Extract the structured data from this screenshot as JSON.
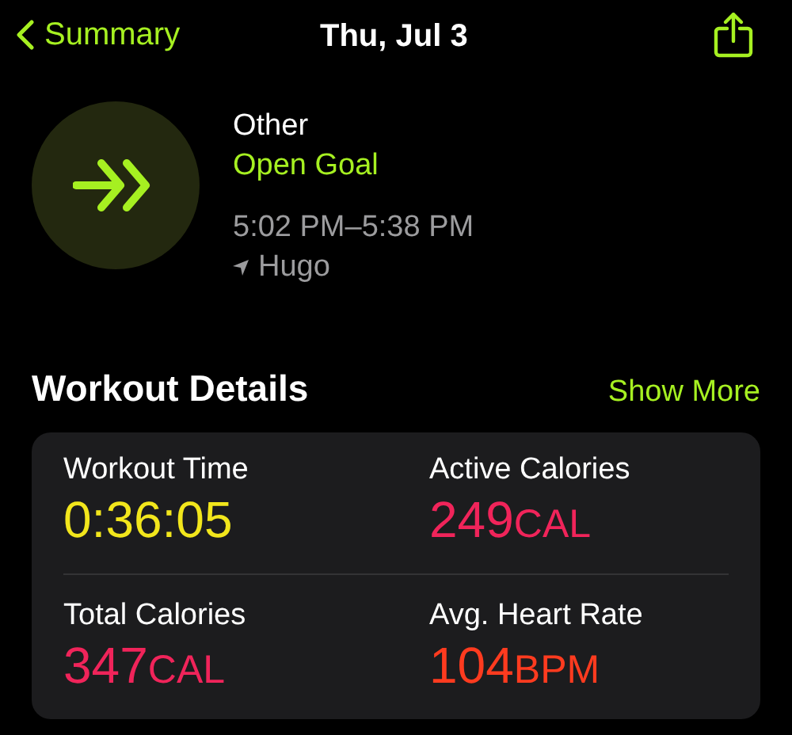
{
  "nav": {
    "back_label": "Summary",
    "title": "Thu, Jul 3"
  },
  "workout": {
    "type": "Other",
    "goal": "Open Goal",
    "time_range": "5:02 PM–5:38 PM",
    "location": "Hugo"
  },
  "details": {
    "title": "Workout Details",
    "action": "Show More",
    "metrics": [
      {
        "label": "Workout Time",
        "value": "0:36:05",
        "color": "#f2e61c"
      },
      {
        "label": "Active Calories",
        "value": "249",
        "unit": "CAL",
        "color": "#f0245a"
      },
      {
        "label": "Total Calories",
        "value": "347",
        "unit": "CAL",
        "color": "#f0245a"
      },
      {
        "label": "Avg. Heart Rate",
        "value": "104",
        "unit": "BPM",
        "color": "#ff3b1f"
      }
    ]
  }
}
